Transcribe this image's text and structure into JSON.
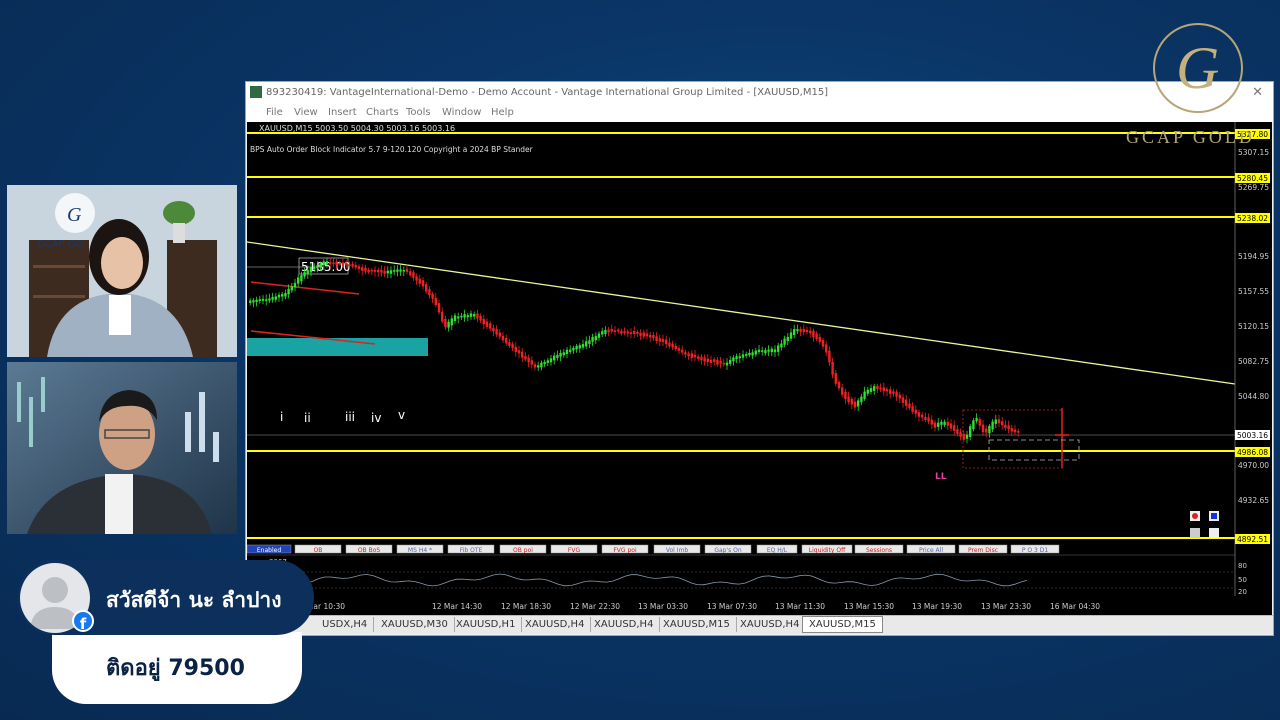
{
  "window": {
    "title": "893230419: VantageInternational-Demo - Demo Account - Vantage International Group Limited - [XAUUSD,M15]",
    "menu": [
      "File",
      "View",
      "Insert",
      "Charts",
      "Tools",
      "Window",
      "Help"
    ]
  },
  "chart": {
    "symbol_info": "XAUUSD,M15  5003.50 5004.30 5003.16 5003.16",
    "indicator_label": "BPS Auto Order Block Indicator  5.7 9-120.120 Copyright a 2024 BP Stander",
    "price_callout": "5185.00",
    "wave_labels": [
      "i",
      "ii",
      "iii",
      "iv",
      "v"
    ],
    "ll_label": "LL",
    "price_axis": [
      "5307.15",
      "5269.75",
      "5194.95",
      "5157.55",
      "5120.15",
      "5082.75",
      "5044.80",
      "4970.00",
      "4932.65"
    ],
    "price_badges": [
      {
        "label": "5327.80",
        "color": "#ffff00"
      },
      {
        "label": "5280.45",
        "color": "#ffff00"
      },
      {
        "label": "5238.02",
        "color": "#ffff00"
      },
      {
        "label": "5003.16",
        "color": "#ffffff"
      },
      {
        "label": "4986.08",
        "color": "#ffff00"
      },
      {
        "label": "4892.51",
        "color": "#ffff00"
      }
    ],
    "buttons": [
      "Enabled",
      "OB",
      "OB BoS",
      "MS H4 *",
      "Fib OTE",
      "OB poi",
      "FVG",
      "FVG poi",
      "Vol Imb",
      "Gap's On",
      "EQ H/L",
      "Liquidity Off",
      "Sessions",
      "Price All",
      "Prem Disc",
      "P O 3   D1"
    ],
    "oscillator_label": "3067",
    "oscillator_axis": [
      "80",
      "50",
      "20"
    ],
    "time_axis": [
      "12 Mar 10:30",
      "12 Mar 14:30",
      "12 Mar 18:30",
      "12 Mar 22:30",
      "13 Mar 03:30",
      "13 Mar 07:30",
      "13 Mar 11:30",
      "13 Mar 15:30",
      "13 Mar 19:30",
      "13 Mar 23:30",
      "16 Mar 04:30"
    ],
    "tabs": [
      "USDX,H4",
      "XAUUSD,M30",
      "XAUUSD,H1",
      "XAUUSD,H4",
      "XAUUSD,H4",
      "XAUUSD,M15",
      "XAUUSD,H4",
      "XAUUSD,M15"
    ],
    "active_tab_index": 7
  },
  "brand": {
    "name": "GCAP GOLD",
    "monogram": "G"
  },
  "cam_logo_text": "GCAP GO",
  "comment": {
    "name": "สวัสดีจ้า นะ ลำปาง",
    "text": "ติดอยู่ 79500",
    "platform_icon": "facebook-icon"
  },
  "colors": {
    "bull": "#33dd33",
    "bear": "#ee2222",
    "level": "#ffff00",
    "trendline": "#e9f59a",
    "ob_zone": "#1aa3a3"
  }
}
